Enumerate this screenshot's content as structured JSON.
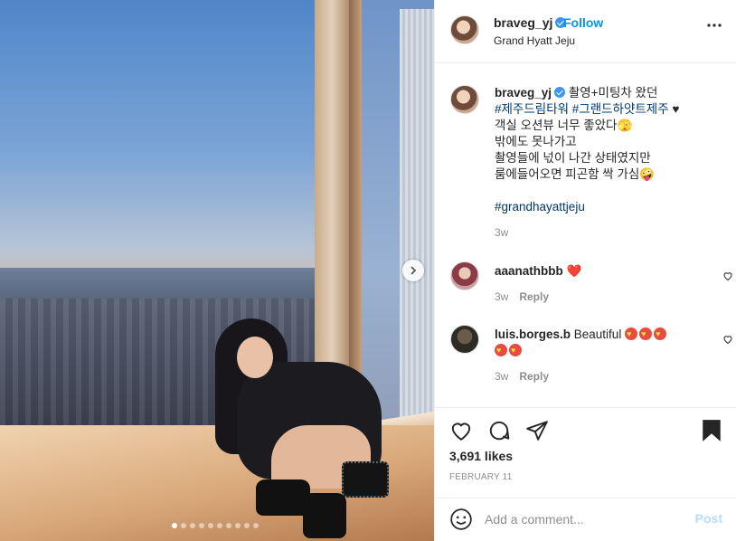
{
  "header": {
    "username": "braveg_yj",
    "follow_label": "Follow",
    "location": "Grand Hyatt Jeju"
  },
  "caption": {
    "username": "braveg_yj",
    "line1": "촬영+미팅차 왔던",
    "line2_tags": "#제주드림타워 #그랜드하얏트제주",
    "line2_heart": "♥",
    "line3": "객실 오션뷰 너무 좋았다🫣",
    "line4": "밖에도 못나가고",
    "line5": "촬영들에 넋이 나간 상태였지만",
    "line6": "룸에들어오면 피곤함 싹 가심🤪",
    "hashtag": "#grandhayattjeju",
    "age": "3w"
  },
  "comments": [
    {
      "username": "aaanathbbb",
      "text": "❤️",
      "age": "3w",
      "reply_label": "Reply"
    },
    {
      "username": "luis.borges.b",
      "text": "Beautiful",
      "age": "3w",
      "reply_label": "Reply"
    }
  ],
  "actions": {
    "likes": "3,691 likes",
    "date": "FEBRUARY 11"
  },
  "add_comment": {
    "placeholder": "Add a comment...",
    "post_label": "Post"
  },
  "carousel": {
    "count": 10,
    "active_index": 0
  },
  "colors": {
    "link": "#0095f6",
    "hashtag": "#00376b",
    "verified": "#3897f0",
    "muted": "#8e8e8e"
  },
  "icons": [
    "verified-icon",
    "more-icon",
    "heart-icon",
    "comment-icon",
    "share-icon",
    "bookmark-icon",
    "smile-icon",
    "chevron-right-icon"
  ]
}
